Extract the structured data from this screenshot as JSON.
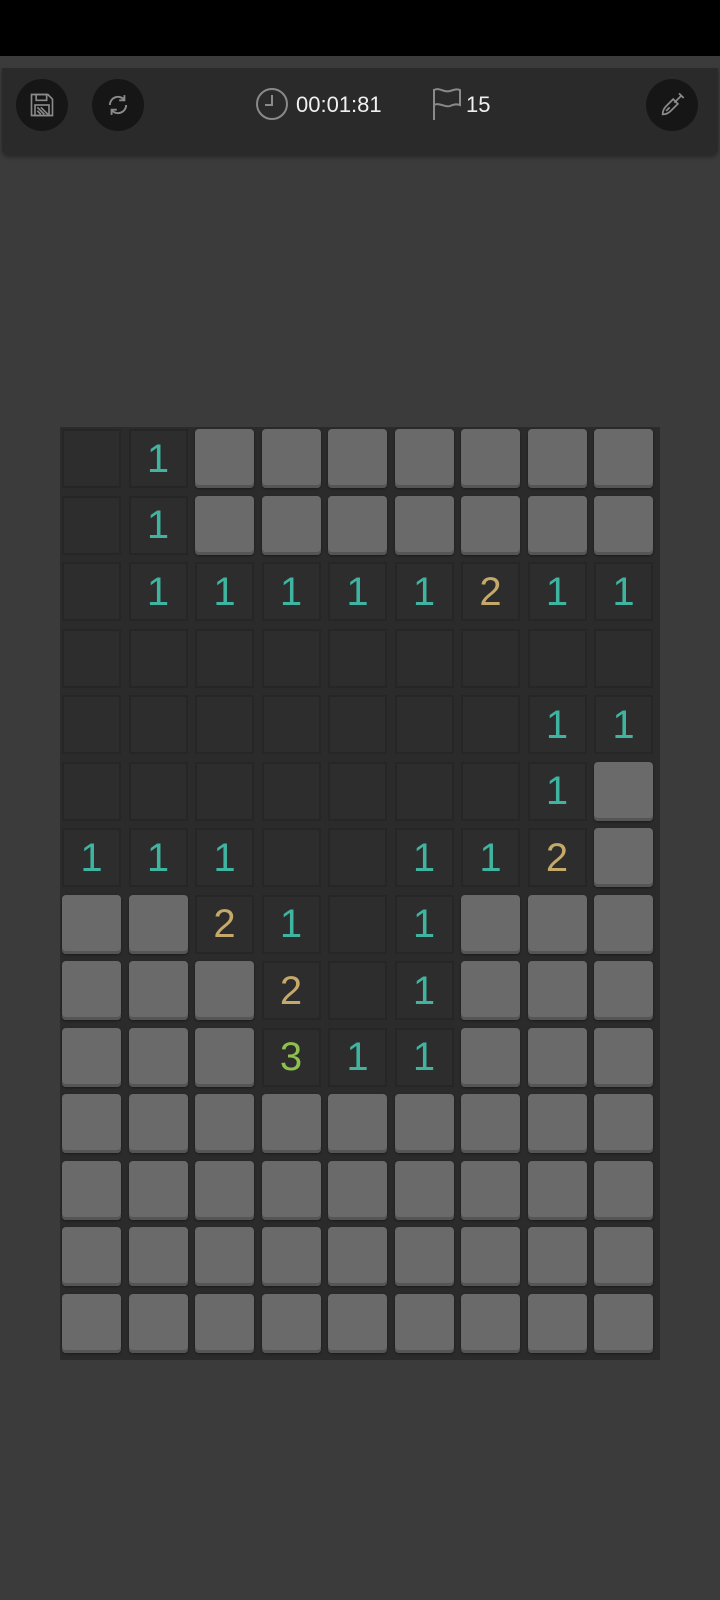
{
  "toolbar": {
    "timer": "00:01:81",
    "flags": "15",
    "icons": [
      "save-icon",
      "restart-icon",
      "timer-icon",
      "flag-icon",
      "shovel-icon"
    ]
  },
  "colors": {
    "background": "#3b3b3b",
    "toolbar": "#2a2a2a",
    "hidden_cell": "#6a6a6a",
    "open_cell": "#2d2d2d",
    "number_1": "#3fb4a0",
    "number_2": "#c4a96a",
    "number_3": "#8fbf4e"
  },
  "board": {
    "columns": 9,
    "rows": [
      [
        "0",
        "1",
        "H",
        "H",
        "H",
        "H",
        "H",
        "H",
        "H"
      ],
      [
        "0",
        "1",
        "H",
        "H",
        "H",
        "H",
        "H",
        "H",
        "H"
      ],
      [
        "0",
        "1",
        "1",
        "1",
        "1",
        "1",
        "2",
        "1",
        "1"
      ],
      [
        "0",
        "0",
        "0",
        "0",
        "0",
        "0",
        "0",
        "0",
        "0"
      ],
      [
        "0",
        "0",
        "0",
        "0",
        "0",
        "0",
        "0",
        "1",
        "1"
      ],
      [
        "0",
        "0",
        "0",
        "0",
        "0",
        "0",
        "0",
        "1",
        "H"
      ],
      [
        "1",
        "1",
        "1",
        "0",
        "0",
        "1",
        "1",
        "2",
        "H"
      ],
      [
        "H",
        "H",
        "2",
        "1",
        "0",
        "1",
        "H",
        "H",
        "H"
      ],
      [
        "H",
        "H",
        "H",
        "2",
        "0",
        "1",
        "H",
        "H",
        "H"
      ],
      [
        "H",
        "H",
        "H",
        "3",
        "1",
        "1",
        "H",
        "H",
        "H"
      ],
      [
        "H",
        "H",
        "H",
        "H",
        "H",
        "H",
        "H",
        "H",
        "H"
      ],
      [
        "H",
        "H",
        "H",
        "H",
        "H",
        "H",
        "H",
        "H",
        "H"
      ],
      [
        "H",
        "H",
        "H",
        "H",
        "H",
        "H",
        "H",
        "H",
        "H"
      ],
      [
        "H",
        "H",
        "H",
        "H",
        "H",
        "H",
        "H",
        "H",
        "H"
      ]
    ]
  }
}
